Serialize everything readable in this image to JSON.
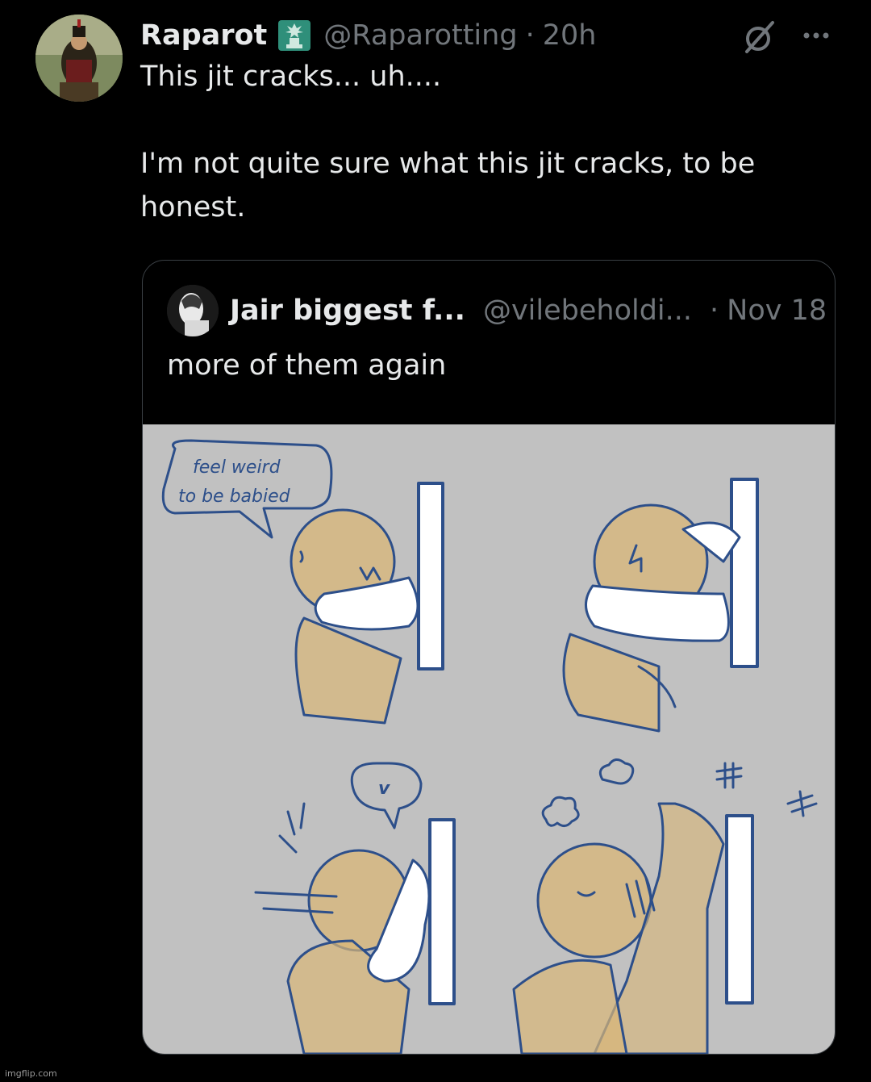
{
  "tweet": {
    "display_name": "Raparot",
    "badge_icon": "statue-of-liberty-icon",
    "handle": "@Raparotting",
    "separator": "·",
    "time": "20h",
    "text_line_1": "This jit cracks... uh....",
    "text_line_2": "I'm not quite sure what this jit cracks, to be",
    "text_line_3": "honest."
  },
  "quoted": {
    "display_name": "Jair biggest f...",
    "handle": "@vilebeholdi...",
    "separator": "·",
    "date": "Nov 18",
    "text": "more of them again",
    "comic": {
      "speech_bubble_line_1": "feel weird",
      "speech_bubble_line_2": "to be babied",
      "heart_bubble": "v"
    }
  },
  "icons": [
    "grok-icon",
    "more-options-icon"
  ],
  "colors": {
    "background": "#000000",
    "text": "#e7e9ea",
    "muted": "#71767b",
    "comic_bg": "#c1c1c1",
    "skin": "#d8b677",
    "ink": "#2d4f8a"
  },
  "watermark": "imgflip.com"
}
